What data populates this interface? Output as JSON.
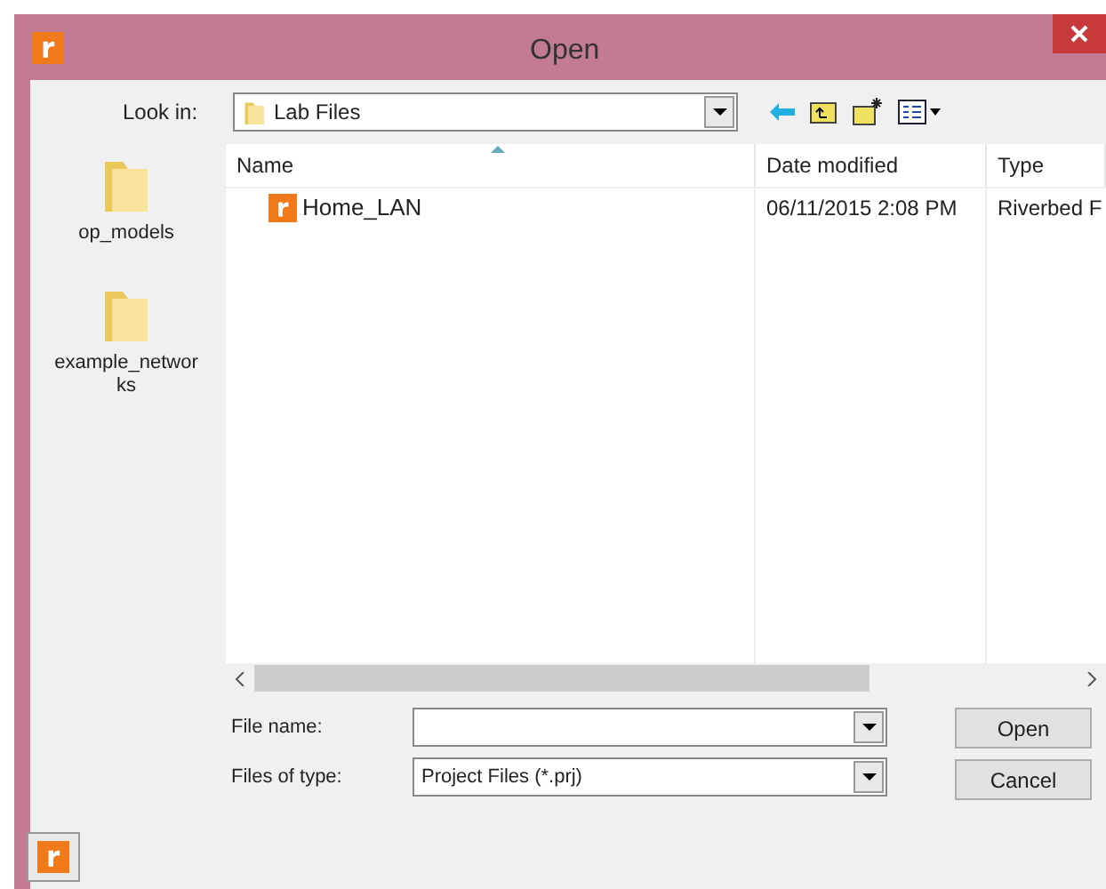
{
  "window": {
    "title": "Open"
  },
  "look_in": {
    "label": "Look in:",
    "value": "Lab Files"
  },
  "places": [
    {
      "label": "op_models"
    },
    {
      "label": "example_networks"
    }
  ],
  "table": {
    "columns": [
      {
        "label": "Name",
        "sorted": true
      },
      {
        "label": "Date modified",
        "sorted": false
      },
      {
        "label": "Type",
        "sorted": false
      }
    ],
    "rows": [
      {
        "name": "Home_LAN",
        "date": "06/11/2015 2:08 PM",
        "type": "Riverbed F"
      }
    ]
  },
  "file_name": {
    "label": "File name:"
  },
  "file_type": {
    "label": "Files of type:",
    "value": "Project Files (*.prj)"
  },
  "buttons": [
    "Open",
    "Cancel"
  ]
}
